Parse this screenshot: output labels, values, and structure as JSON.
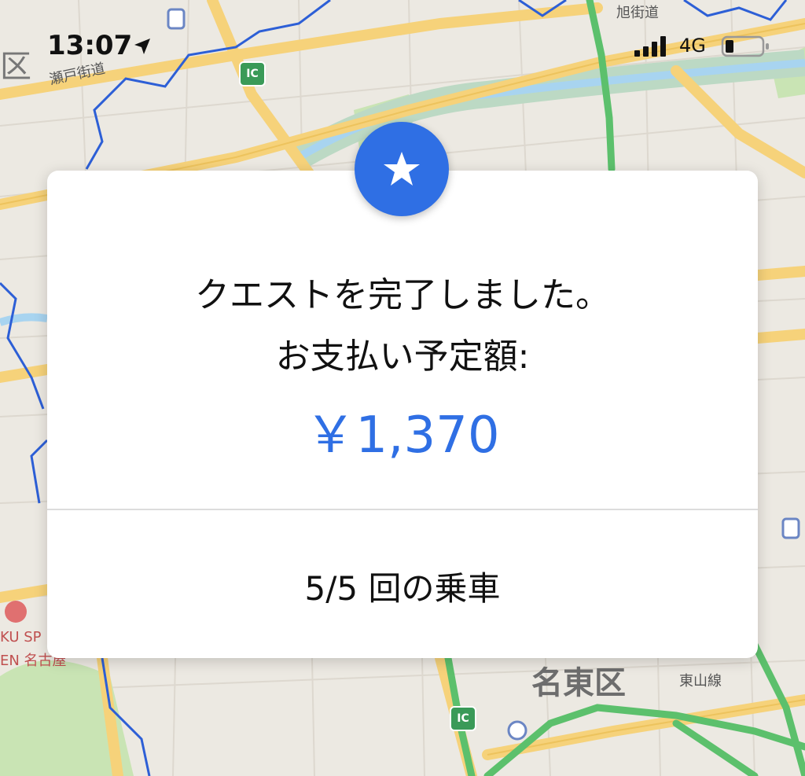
{
  "status_bar": {
    "time": "13:07",
    "network": "4G",
    "icons": [
      "location-arrow-icon",
      "signal-bars-icon",
      "battery-icon"
    ]
  },
  "map": {
    "labels": {
      "ward_left": "区",
      "seto_kaido": "瀬戸街道",
      "asahi_kaido": "旭街道",
      "ic_top": "IC",
      "ic_bottom": "IC",
      "meito_ku": "名東区",
      "higashiyama_line": "東山線",
      "spa_1": "KU SP",
      "spa_2": "EN 名古屋"
    },
    "colors": {
      "land": "#ece9e2",
      "road": "#f6d27a",
      "river": "#a8d4f0",
      "park": "#c9e4b4",
      "expressway": "#5cc06c",
      "boundary": "#2d5fd6"
    }
  },
  "card": {
    "title_line1": "クエストを完了しました。",
    "title_line2": "お支払い予定額:",
    "amount": "￥1,370",
    "rides": "5/5 回の乗車",
    "accent_color": "#2f6fe4",
    "badge_icon": "star-icon"
  }
}
